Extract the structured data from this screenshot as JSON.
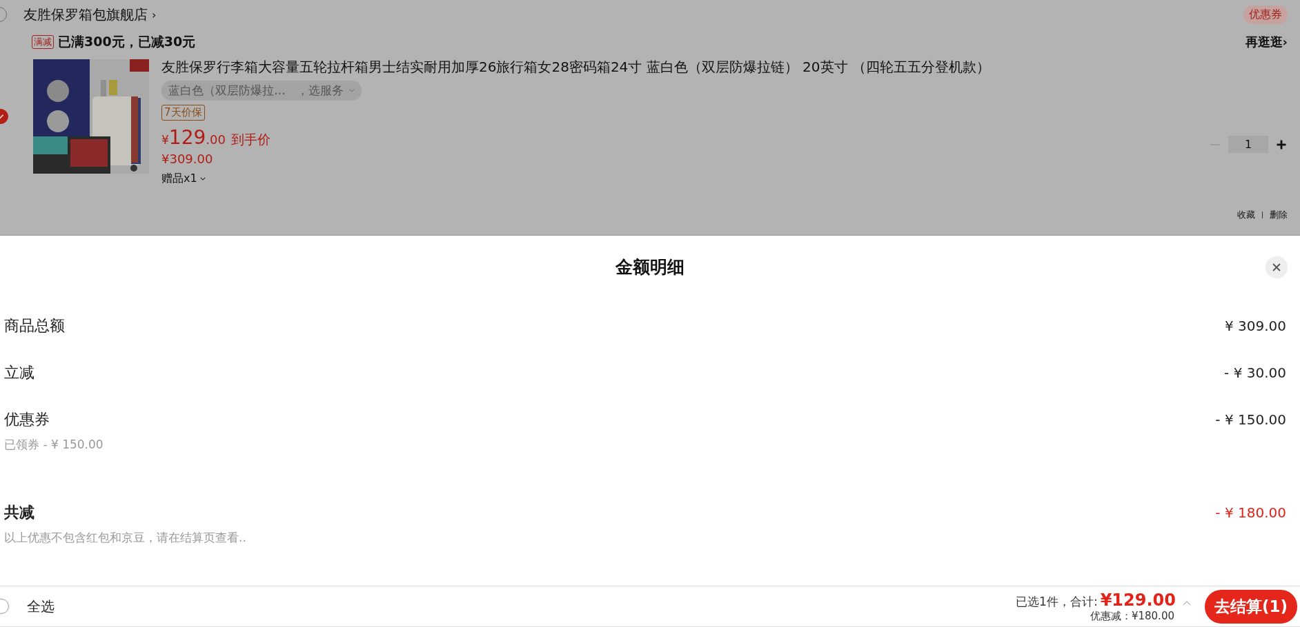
{
  "store": {
    "name": "友胜保罗箱包旗舰店",
    "arrow": "›",
    "checked": false,
    "coupon_button": "优惠券"
  },
  "promotion": {
    "tag": "满减",
    "text": "已满300元，已减30元",
    "link": "再逛逛›"
  },
  "product": {
    "checked": true,
    "title": "友胜保罗行李箱大容量五轮拉杆箱男士结实耐用加厚26旅行箱女28密码箱24寸 蓝白色（双层防爆拉链） 20英寸 （四轮五五分登机款）",
    "spec": "蓝白色（双层防爆拉…",
    "service": "，选服务",
    "tag": "7天价保",
    "price_symbol": "¥",
    "price_int": "129",
    "price_dec": ".00",
    "price_label": "到手价",
    "original_price": "¥309.00",
    "gift": "赠品x1",
    "quantity": "1",
    "actions": [
      "收藏",
      "删除"
    ]
  },
  "sheet": {
    "title": "金额明细",
    "rows": [
      {
        "label": "商品总额",
        "value": "¥ 309.00"
      },
      {
        "label": "立减",
        "value": "- ¥ 30.00"
      },
      {
        "label": "优惠券",
        "value": "- ¥ 150.00",
        "note": "已领券 - ¥ 150.00"
      }
    ],
    "total": {
      "label": "共减",
      "value": "- ¥ 180.00",
      "note": "以上优惠不包含红包和京豆，请在结算页查看.."
    }
  },
  "footer": {
    "select_all": {
      "label": "全选",
      "checked": false
    },
    "summary": "已选1件，合计:",
    "total": "¥129.00",
    "discount": "优惠减：¥180.00",
    "checkout": "去结算(1)"
  }
}
